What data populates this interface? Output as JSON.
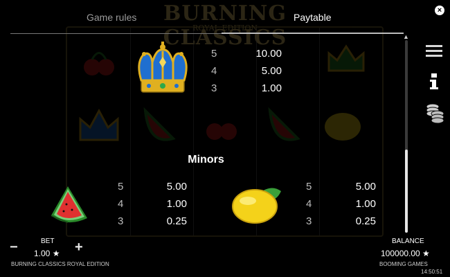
{
  "tabs": {
    "game_rules": "Game rules",
    "paytable": "Paytable"
  },
  "background": {
    "logo_title": "BURNING CLASSICS",
    "logo_subtitle": "ROYAL EDITION"
  },
  "crown": {
    "icon": "crown-icon",
    "rows": [
      {
        "count": "5",
        "value": "10.00"
      },
      {
        "count": "4",
        "value": "5.00"
      },
      {
        "count": "3",
        "value": "1.00"
      }
    ]
  },
  "minors": {
    "title": "Minors",
    "watermelon": {
      "icon": "watermelon-icon",
      "rows": [
        {
          "count": "5",
          "value": "5.00"
        },
        {
          "count": "4",
          "value": "1.00"
        },
        {
          "count": "3",
          "value": "0.25"
        }
      ]
    },
    "lemon": {
      "icon": "lemon-icon",
      "rows": [
        {
          "count": "5",
          "value": "5.00"
        },
        {
          "count": "4",
          "value": "1.00"
        },
        {
          "count": "3",
          "value": "0.25"
        }
      ]
    }
  },
  "bottom": {
    "bet_label": "BET",
    "bet_value": "1.00 ★",
    "minus": "−",
    "plus": "+",
    "game_name": "BURNING CLASSICS ROYAL EDITION",
    "balance_label": "BALANCE",
    "balance_value": "100000.00 ★",
    "brand": "BOOMING GAMES",
    "clock": "14:50:51"
  },
  "colors": {
    "background": "#000000",
    "accent_gold": "#e0b020",
    "crown_blue": "#1f6fd0"
  }
}
